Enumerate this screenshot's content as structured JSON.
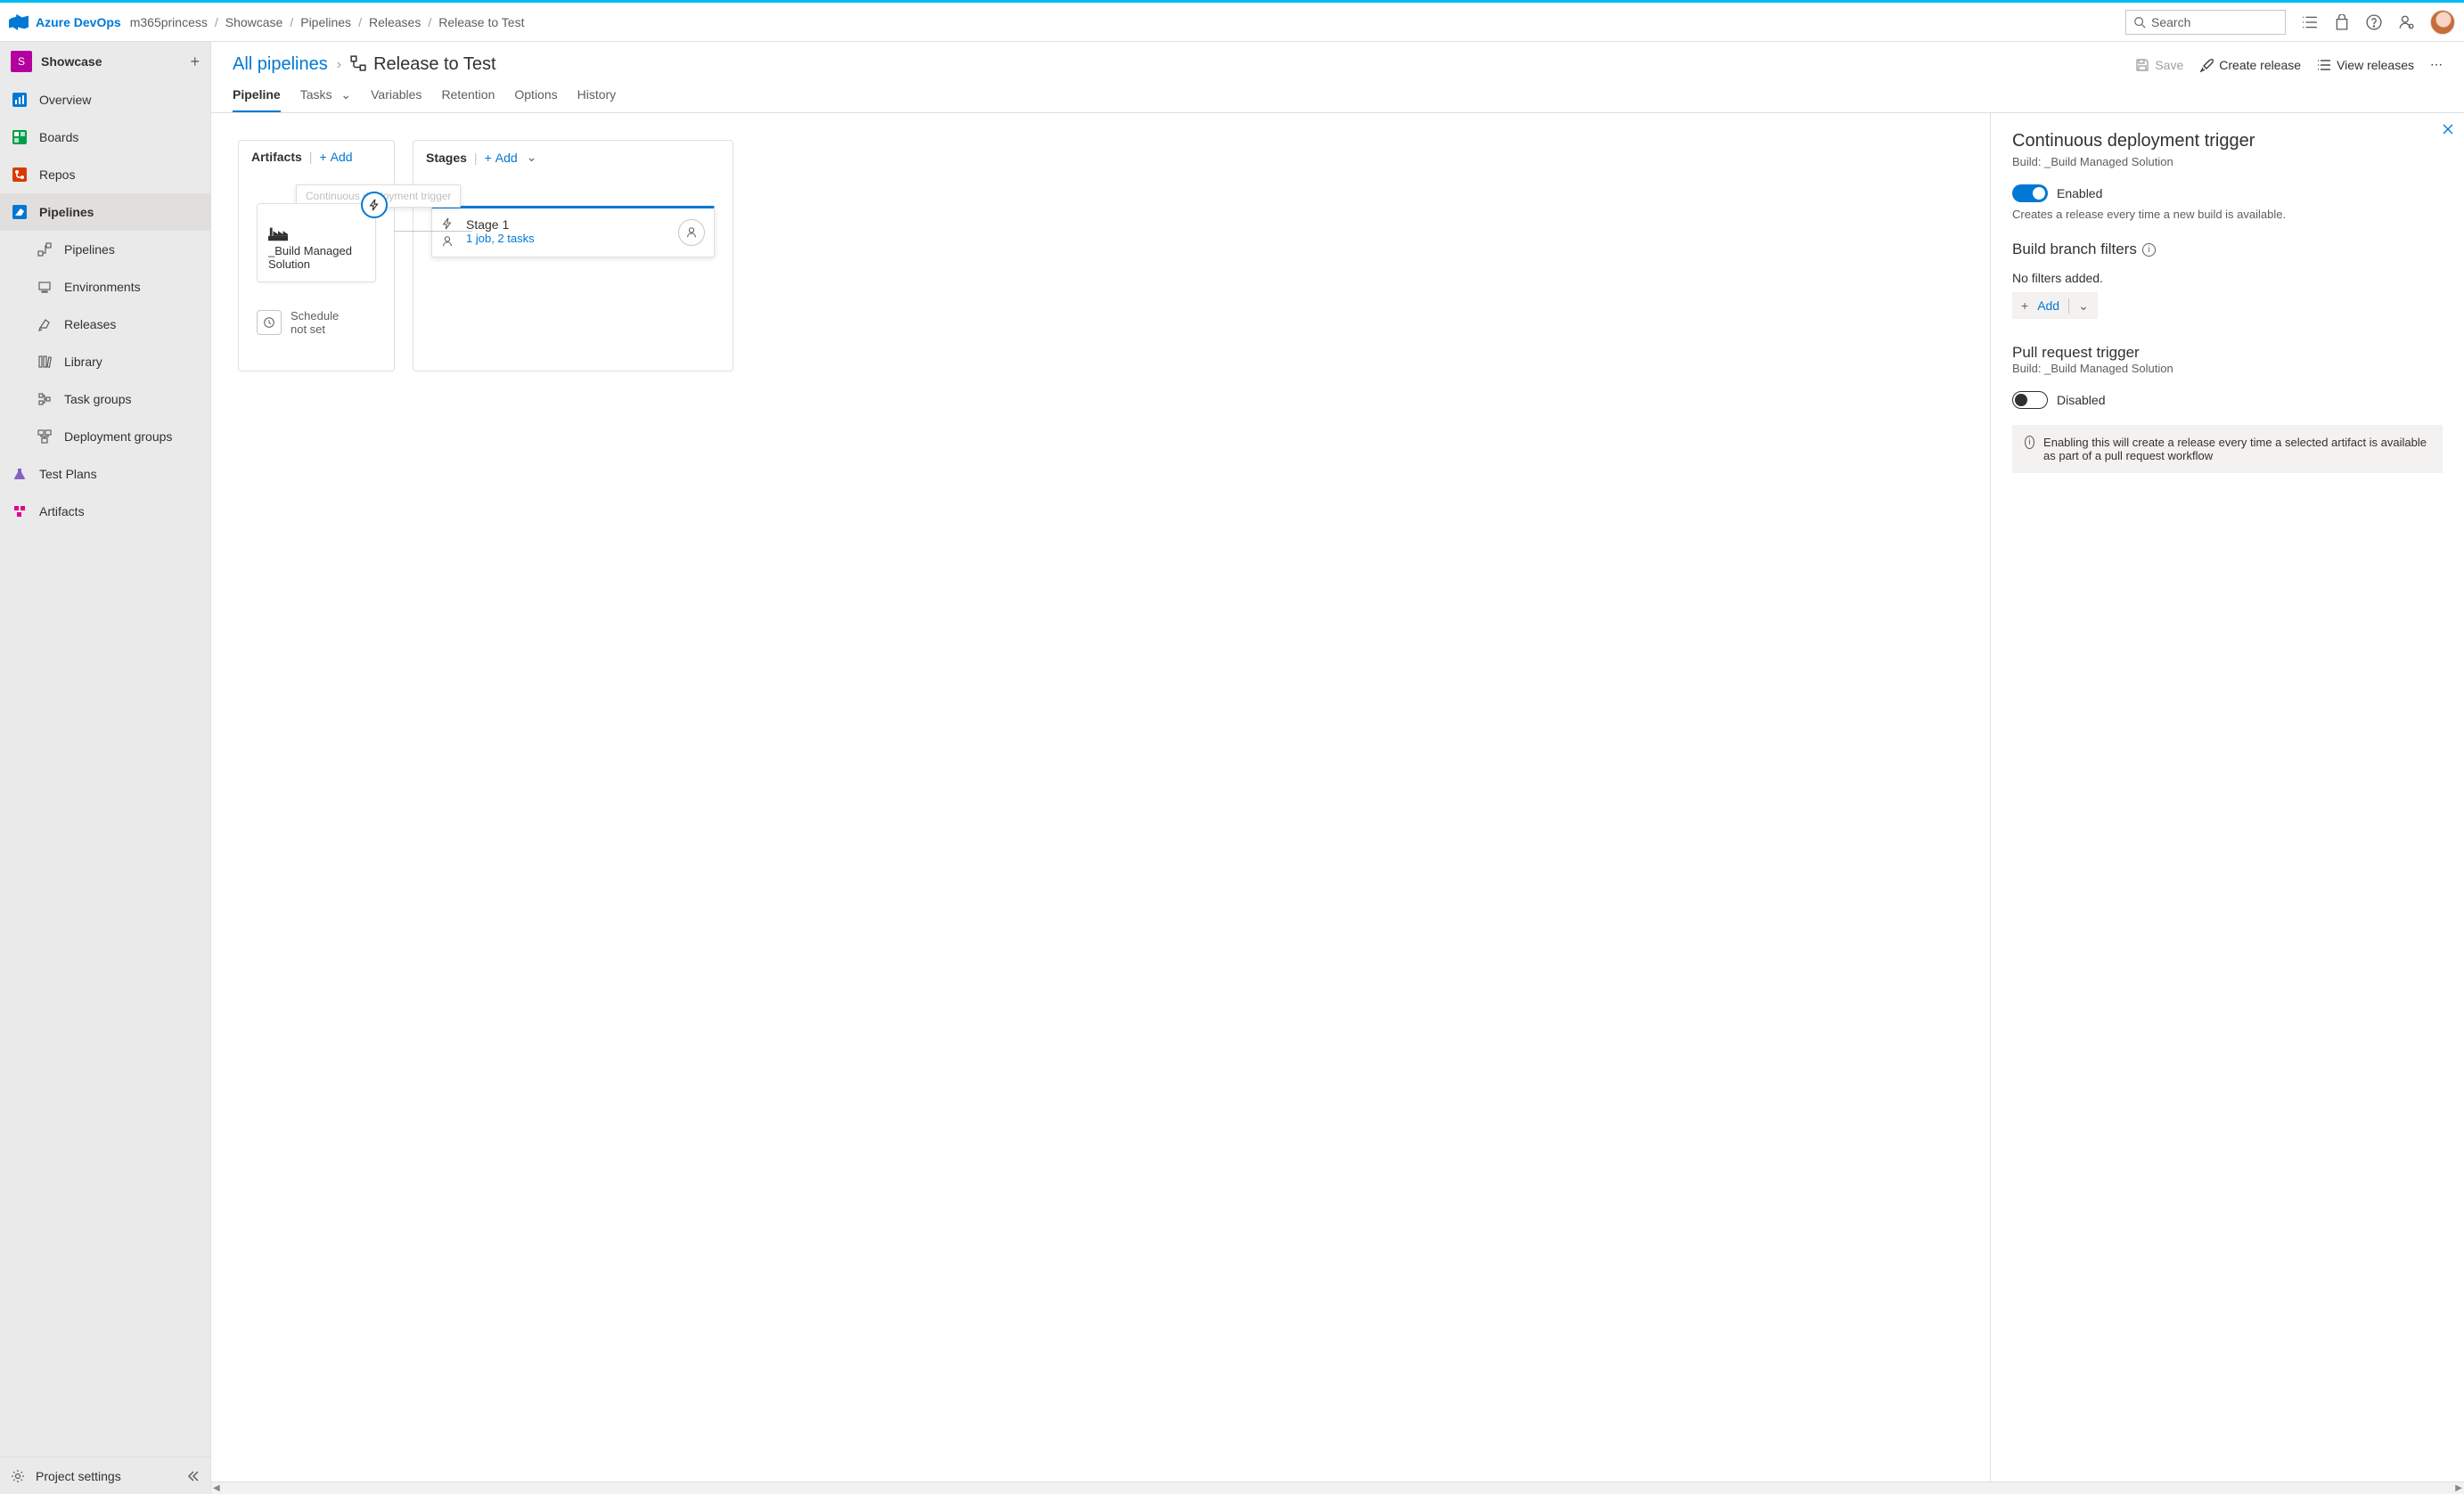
{
  "top": {
    "brand": "Azure DevOps",
    "org": "m365princess",
    "bc": [
      "Showcase",
      "Pipelines",
      "Releases",
      "Release to Test"
    ],
    "search_placeholder": "Search"
  },
  "project": {
    "name": "Showcase",
    "initial": "S"
  },
  "sidebar": {
    "items": [
      {
        "label": "Overview"
      },
      {
        "label": "Boards"
      },
      {
        "label": "Repos"
      },
      {
        "label": "Pipelines"
      },
      {
        "label": "Test Plans"
      },
      {
        "label": "Artifacts"
      }
    ],
    "sub_pipelines": [
      {
        "label": "Pipelines"
      },
      {
        "label": "Environments"
      },
      {
        "label": "Releases"
      },
      {
        "label": "Library"
      },
      {
        "label": "Task groups"
      },
      {
        "label": "Deployment groups"
      }
    ],
    "settings": "Project settings"
  },
  "toolbar": {
    "all": "All pipelines",
    "title": "Release to Test",
    "save": "Save",
    "create": "Create release",
    "view": "View releases"
  },
  "tabs": [
    "Pipeline",
    "Tasks",
    "Variables",
    "Retention",
    "Options",
    "History"
  ],
  "artifacts": {
    "title": "Artifacts",
    "add": "Add",
    "card_name": "_Build Managed Solution",
    "tooltip": "Continuous deployment trigger",
    "schedule_l1": "Schedule",
    "schedule_l2": "not set"
  },
  "stages": {
    "title": "Stages",
    "add": "Add",
    "stage_name": "Stage 1",
    "stage_sub": "1 job, 2 tasks"
  },
  "panel": {
    "cd_title": "Continuous deployment trigger",
    "cd_sub": "Build: _Build Managed Solution",
    "enabled": "Enabled",
    "cd_desc": "Creates a release every time a new build is available.",
    "branch_title": "Build branch filters",
    "no_filters": "No filters added.",
    "add": "Add",
    "pr_title": "Pull request trigger",
    "pr_sub": "Build: _Build Managed Solution",
    "disabled": "Disabled",
    "info": "Enabling this will create a release every time a selected artifact is available as part of a pull request workflow"
  }
}
